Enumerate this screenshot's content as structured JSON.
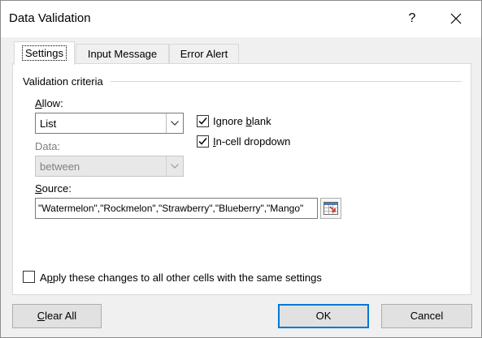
{
  "window": {
    "title": "Data Validation",
    "help_label": "?"
  },
  "tabs": [
    {
      "label": "Settings",
      "active": true
    },
    {
      "label": "Input Message",
      "active": false
    },
    {
      "label": "Error Alert",
      "active": false
    }
  ],
  "criteria": {
    "group_title": "Validation criteria",
    "allow": {
      "label_pre": "",
      "label_key": "A",
      "label_post": "llow:",
      "value": "List"
    },
    "data": {
      "label": "Data:",
      "value": "between",
      "disabled": true
    },
    "ignore_blank": {
      "label_pre": "Ignore ",
      "label_key": "b",
      "label_post": "lank",
      "checked": true
    },
    "incell_dropdown": {
      "label_pre": "",
      "label_key": "I",
      "label_post": "n-cell dropdown",
      "checked": true
    },
    "source": {
      "label_pre": "",
      "label_key": "S",
      "label_post": "ource:",
      "value": "\"Watermelon\",\"Rockmelon\",\"Strawberry\",\"Blueberry\",\"Mango\""
    }
  },
  "apply_all": {
    "label_pre": "A",
    "label_key": "p",
    "label_post": "ply these changes to all other cells with the same settings",
    "checked": false
  },
  "buttons": {
    "clear_all": {
      "label_pre": "",
      "label_key": "C",
      "label_post": "lear All"
    },
    "ok": "OK",
    "cancel": "Cancel"
  },
  "colors": {
    "accent": "#0078d7",
    "panel": "#ffffff",
    "background": "#f0f0f0"
  }
}
